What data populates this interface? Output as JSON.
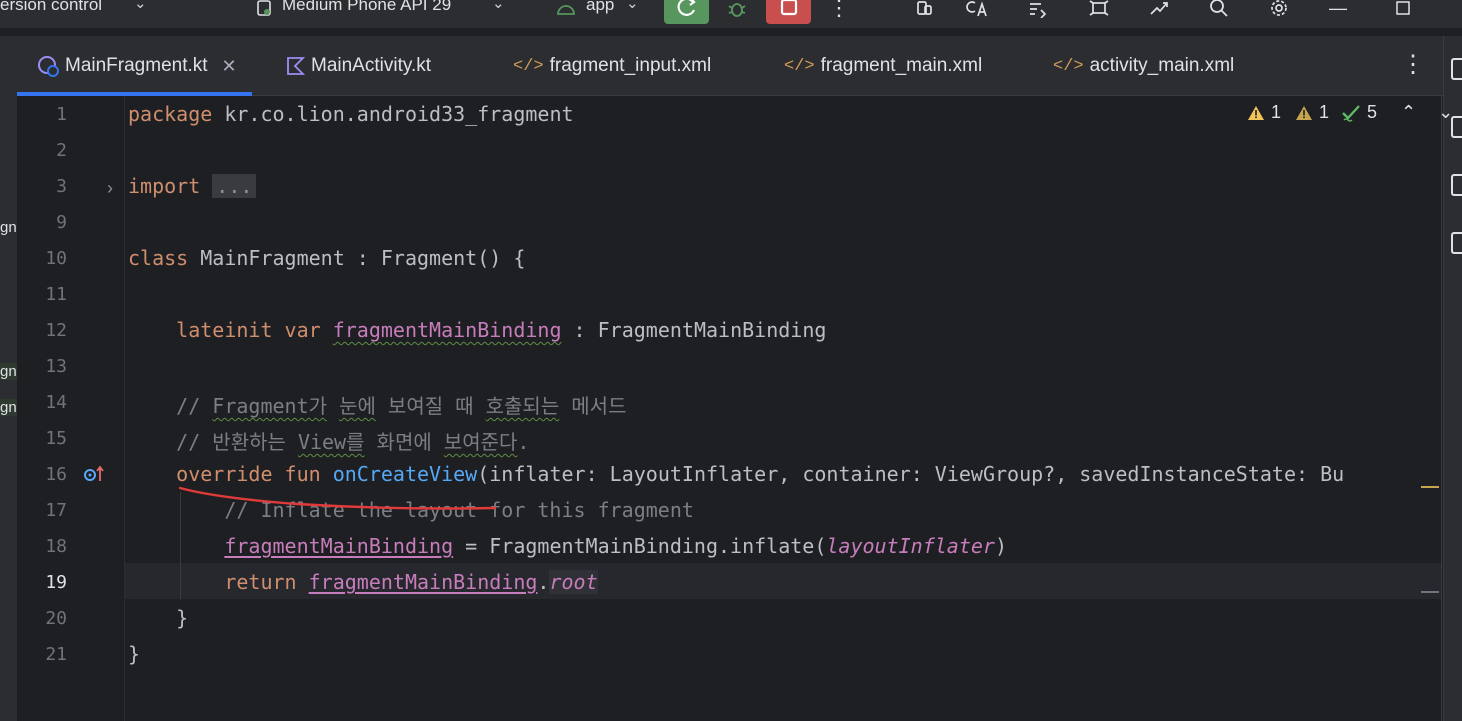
{
  "toolbar": {
    "vcs_label": "ersion control",
    "device_label": "Medium Phone API 29",
    "config_label": "app"
  },
  "tabs": [
    {
      "label": "MainFragment.kt",
      "active": true
    },
    {
      "label": "MainActivity.kt",
      "active": false
    },
    {
      "label": "fragment_input.xml",
      "active": false
    },
    {
      "label": "fragment_main.xml",
      "active": false
    },
    {
      "label": "activity_main.xml",
      "active": false
    }
  ],
  "left_strip": {
    "label_1": "gn",
    "label_2": "gn",
    "label_3": "gn"
  },
  "problems": {
    "warnings": "1",
    "weak_warnings": "1",
    "typos": "5"
  },
  "editor": {
    "line_numbers": [
      "1",
      "2",
      "3",
      "9",
      "10",
      "11",
      "12",
      "13",
      "14",
      "15",
      "16",
      "17",
      "18",
      "19",
      "20",
      "21"
    ],
    "current_line": "19",
    "lines": {
      "l1_kw": "package",
      "l1_rest": " kr.co.lion.android33_fragment",
      "l3_kw": "import",
      "l3_fold": "...",
      "l10_kw": "class",
      "l10_rest": " MainFragment : Fragment() {",
      "l12_kw": "lateinit var",
      "l12_prop": "fragmentMainBinding",
      "l12_rest": " : FragmentMainBinding",
      "l14_prefix": "// ",
      "l14_w1": "Fragment가",
      "l14_sp1": " ",
      "l14_w2": "눈에",
      "l14_mid": " 보여질 때 ",
      "l14_w3": "호출되는",
      "l14_end": " 메서드",
      "l15_prefix": "// 반환하는 ",
      "l15_w1": "View를",
      "l15_mid": " 화면에 ",
      "l15_w2": "보여준다",
      "l15_end": ".",
      "l16_kw": "override fun",
      "l16_fn": "onCreateView",
      "l16_rest": "(inflater: LayoutInflater, container: ViewGroup?, savedInstanceState: Bu",
      "l17": "// Inflate the layout for this fragment",
      "l18_prop": "fragmentMainBinding",
      "l18_mid": " = FragmentMainBinding.inflate(",
      "l18_ital": "layoutInflater",
      "l18_end": ")",
      "l19_kw": "return",
      "l19_prop": "fragmentMainBinding",
      "l19_dot": ".",
      "l19_ital": "root",
      "l20": "}",
      "l21": "}"
    }
  }
}
